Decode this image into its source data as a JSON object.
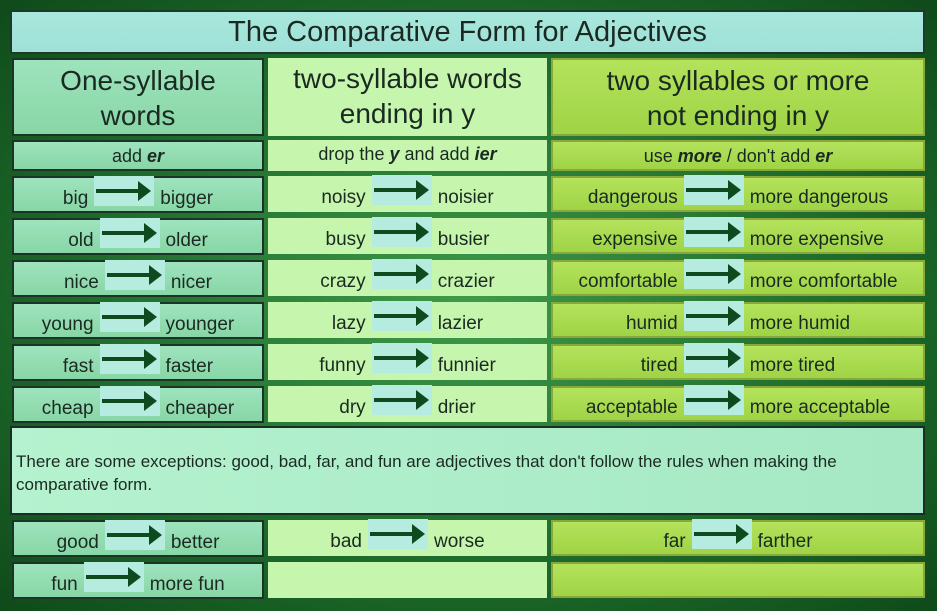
{
  "title": "The Comparative Form for Adjectives",
  "columns": [
    {
      "header_line1": "One-syllable",
      "header_line2": "words",
      "rule_pre": "add ",
      "rule_b1": "er",
      "rule_mid": "",
      "rule_b2": "",
      "rule_post": ""
    },
    {
      "header_line1": "two-syllable words",
      "header_line2": "ending in y",
      "rule_pre": "drop the ",
      "rule_b1": "y",
      "rule_mid": " and add ",
      "rule_b2": "ier",
      "rule_post": ""
    },
    {
      "header_line1": "two syllables or more",
      "header_line2": "not ending in y",
      "rule_pre": "use ",
      "rule_b1": "more",
      "rule_mid": " / don't add ",
      "rule_b2": "er",
      "rule_post": ""
    }
  ],
  "rows": [
    [
      [
        "big",
        "bigger"
      ],
      [
        "noisy",
        "noisier"
      ],
      [
        "dangerous",
        "more dangerous"
      ]
    ],
    [
      [
        "old",
        "older"
      ],
      [
        "busy",
        "busier"
      ],
      [
        "expensive",
        "more expensive"
      ]
    ],
    [
      [
        "nice",
        "nicer"
      ],
      [
        "crazy",
        "crazier"
      ],
      [
        "comfortable",
        "more comfortable"
      ]
    ],
    [
      [
        "young",
        "younger"
      ],
      [
        "lazy",
        "lazier"
      ],
      [
        "humid",
        "more humid"
      ]
    ],
    [
      [
        "fast",
        "faster"
      ],
      [
        "funny",
        "funnier"
      ],
      [
        "tired",
        "more tired"
      ]
    ],
    [
      [
        "cheap",
        "cheaper"
      ],
      [
        "dry",
        "drier"
      ],
      [
        "acceptable",
        "more acceptable"
      ]
    ]
  ],
  "exceptions_text": "There are some exceptions: good, bad, far, and fun are adjectives that don't follow the rules when making the comparative form.",
  "exception_rows": [
    [
      [
        "good",
        "better"
      ],
      [
        "bad",
        "worse"
      ],
      [
        "far",
        "farther"
      ]
    ],
    [
      [
        "fun",
        "more fun"
      ],
      null,
      null
    ]
  ],
  "arrow_color": "#0d4a1e"
}
